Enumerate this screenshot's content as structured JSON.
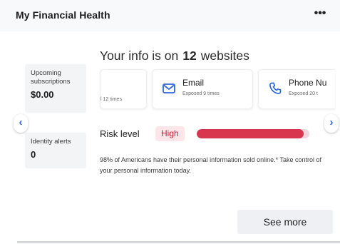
{
  "header": {
    "title": "My Financial Health",
    "more_label": "•••"
  },
  "stats": {
    "subscriptions": {
      "label": "Upcoming subscriptions",
      "value": "$0.00"
    },
    "identity_alerts": {
      "label": "Identity alerts",
      "value": "0"
    }
  },
  "nav": {
    "prev_icon": "‹",
    "next_icon": "›"
  },
  "headline": {
    "prefix": "Your info is on",
    "count": "12",
    "suffix": "websites"
  },
  "exposures": [
    {
      "title": "",
      "detail": "l 12 times",
      "icon": "none"
    },
    {
      "title": "Email",
      "detail": "Exposed 9 times",
      "icon": "mail-icon"
    },
    {
      "title": "Phone Nu",
      "detail": "Exposed 20 t",
      "icon": "phone-icon"
    }
  ],
  "risk": {
    "label": "Risk level",
    "level": "High",
    "level_fraction": 0.95,
    "color": "#d8354f"
  },
  "description": "98% of Americans have their personal information sold online.* Take control of your personal information today.",
  "actions": {
    "see_more": "See more"
  },
  "colors": {
    "accent": "#2e67d8",
    "risk_high": "#d8354f",
    "badge_bg": "#fde6ea"
  }
}
